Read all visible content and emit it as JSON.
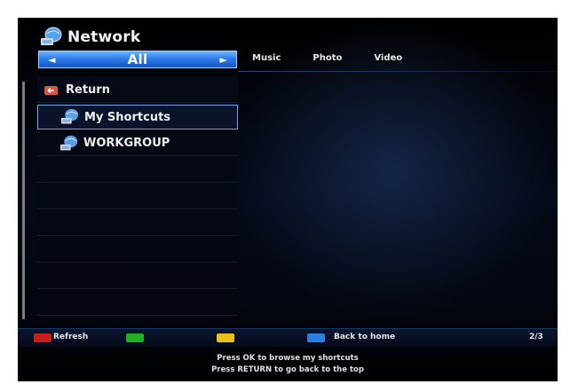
{
  "header": {
    "title": "Network",
    "icon": "network-globe-icon"
  },
  "category_selector": {
    "left_arrow": "◄",
    "value": "All",
    "right_arrow": "►"
  },
  "tabs": [
    {
      "label": "Music"
    },
    {
      "label": "Photo"
    },
    {
      "label": "Video"
    }
  ],
  "list": {
    "items": [
      {
        "label": "Return",
        "icon": "return-icon"
      },
      {
        "label": "My Shortcuts",
        "icon": "network-globe-icon",
        "selected": true
      },
      {
        "label": "WORKGROUP",
        "icon": "network-globe-icon"
      }
    ]
  },
  "footer": {
    "red_label": "Refresh",
    "blue_label": "Back to home",
    "page": "2/3",
    "colors": {
      "red": "#c81e1e",
      "green": "#22b022",
      "yellow": "#e8c020",
      "blue": "#2f7fe0"
    }
  },
  "hints": {
    "line1": "Press OK to browse my shortcuts",
    "line2": "Press RETURN to go back to the top"
  }
}
